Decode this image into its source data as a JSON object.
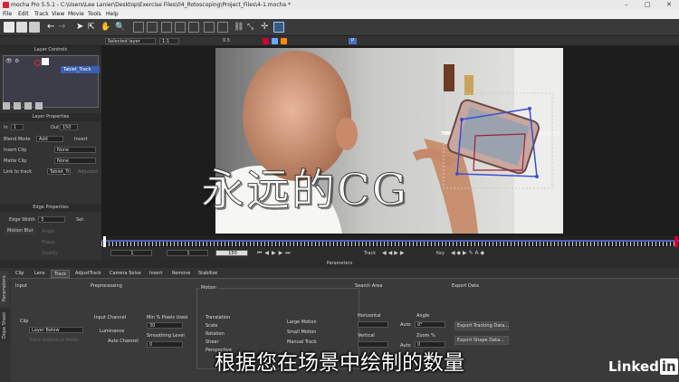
{
  "window": {
    "title": "mocha Pro 5.5.1 - C:\\Users\\Lee Lanier\\Desktop\\Exercise Files\\04_Rotoscoping\\Project_Files\\4-1.mocha *"
  },
  "menu": [
    "File",
    "Edit",
    "Track",
    "View",
    "Movie",
    "Tools",
    "Help"
  ],
  "viewer": {
    "layer_select": "Selected layer",
    "zoom": "1:1",
    "opacity": "0.5",
    "frame_tag": "P"
  },
  "layer_controls": {
    "title": "Layer Controls",
    "layer_name": "Tablet_Track"
  },
  "layer_properties": {
    "title": "Layer Properties",
    "in_label": "In",
    "in_value": "1",
    "out_label": "Out",
    "out_value": "150",
    "blend_mode_label": "Blend Mode",
    "blend_mode_value": "Add",
    "invert_label": "Invert",
    "insert_clip_label": "Insert Clip",
    "insert_clip_value": "None",
    "matte_clip_label": "Matte Clip",
    "matte_clip_value": "None",
    "link_label": "Link to track",
    "link_value": "Tablet_Tr",
    "adjusted_label": "Adjusted"
  },
  "edge_properties": {
    "title": "Edge Properties",
    "width_label": "Edge Width",
    "width_value": "3",
    "set_label": "Set",
    "motion_blur_label": "Motion Blur",
    "angle_label": "Angle",
    "phase_label": "Phase",
    "quality_label": "Quality"
  },
  "timeline": {
    "start": "1",
    "current": "1",
    "end": "150",
    "track_label": "Track",
    "key_label": "Key"
  },
  "params": {
    "title": "Parameters",
    "tabs": [
      "Clip",
      "Lens",
      "Track",
      "AdjustTrack",
      "Camera Solve",
      "Insert",
      "Remove",
      "Stabilize"
    ],
    "side_tabs": [
      "Parameters",
      "Dope Sheet"
    ],
    "input": {
      "title": "Input",
      "clip_label": "Clip",
      "clip_value": "Layer Below",
      "track_individual": "Track Individual Fields"
    },
    "preprocessing": {
      "title": "Preprocessing",
      "input_channel": "Input Channel",
      "luminance": "Luminance",
      "auto_channel": "Auto Channel",
      "min_pixels_label": "Min % Pixels Used",
      "min_pixels_value": "30",
      "smoothing_label": "Smoothing Level",
      "smoothing_value": "0"
    },
    "motion": {
      "title": "Motion",
      "items": [
        "Translation",
        "Scale",
        "Rotation",
        "Shear",
        "Perspective"
      ],
      "large": "Large Motion",
      "small": "Small Motion",
      "manual": "Manual Track"
    },
    "search_area": {
      "title": "Search Area",
      "horizontal": "Horizontal",
      "vertical": "Vertical",
      "auto": "Auto",
      "angle_label": "Angle",
      "angle_value": "0°",
      "zoom_label": "Zoom %",
      "zoom_value": "0"
    },
    "export": {
      "title": "Export Data",
      "tracking_button": "Export Tracking Data...",
      "shape_button": "Export Shape Data..."
    }
  },
  "overlay": {
    "watermark": "永远的CG",
    "subtitle": "根据您在场景中绘制的数量",
    "brand": "Linked",
    "brand_in": "in"
  }
}
